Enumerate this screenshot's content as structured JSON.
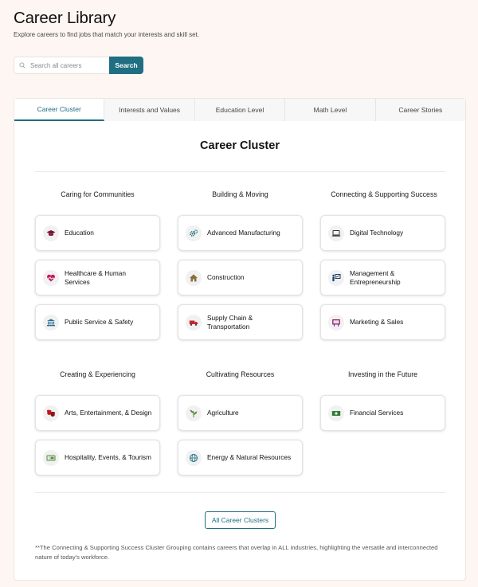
{
  "header": {
    "title": "Career Library",
    "subtitle": "Explore careers to find jobs that match your interests and skill set."
  },
  "search": {
    "placeholder": "Search all careers",
    "button_label": "Search"
  },
  "tabs": [
    {
      "label": "Career Cluster",
      "active": true
    },
    {
      "label": "Interests and Values",
      "active": false
    },
    {
      "label": "Education Level",
      "active": false
    },
    {
      "label": "Math Level",
      "active": false
    },
    {
      "label": "Career Stories",
      "active": false
    }
  ],
  "main": {
    "title": "Career Cluster",
    "groups": [
      {
        "heading": "Caring for Communities",
        "items": [
          {
            "label": "Education",
            "icon": "graduation-cap-icon",
            "color": "#7a1035"
          },
          {
            "label": "Healthcare & Human Services",
            "icon": "heart-pulse-icon",
            "color": "#c2185b"
          },
          {
            "label": "Public Service & Safety",
            "icon": "government-building-icon",
            "color": "#2a6f97"
          }
        ]
      },
      {
        "heading": "Building & Moving",
        "items": [
          {
            "label": "Advanced Manufacturing",
            "icon": "gears-icon",
            "color": "#1f6e82"
          },
          {
            "label": "Construction",
            "icon": "house-icon",
            "color": "#8a6d3b"
          },
          {
            "label": "Supply Chain & Transportation",
            "icon": "truck-icon",
            "color": "#c62828"
          }
        ]
      },
      {
        "heading": "Connecting & Supporting Success",
        "items": [
          {
            "label": "Digital Technology",
            "icon": "laptop-icon",
            "color": "#333333"
          },
          {
            "label": "Management & Entrepreneurship",
            "icon": "presentation-icon",
            "color": "#1a3a6b"
          },
          {
            "label": "Marketing & Sales",
            "icon": "billboard-icon",
            "color": "#7b1f6a"
          }
        ]
      },
      {
        "heading": "Creating & Experiencing",
        "items": [
          {
            "label": "Arts, Entertainment, & Design",
            "icon": "theater-masks-icon",
            "color": "#b71c1c"
          },
          {
            "label": "Hospitality, Events, & Tourism",
            "icon": "ticket-icon",
            "color": "#4f8a3c"
          }
        ]
      },
      {
        "heading": "Cultivating Resources",
        "items": [
          {
            "label": "Agriculture",
            "icon": "plant-icon",
            "color": "#4f8a3c"
          },
          {
            "label": "Energy & Natural Resources",
            "icon": "globe-leaf-icon",
            "color": "#1f6e82"
          }
        ]
      },
      {
        "heading": "Investing in the Future",
        "items": [
          {
            "label": "Financial Services",
            "icon": "money-bills-icon",
            "color": "#2e7d32"
          }
        ]
      }
    ],
    "all_clusters_label": "All Career Clusters",
    "footnote": "**The Connecting & Supporting Success Cluster Grouping contains careers that overlap in ALL industries, highlighting the versatile and interconnected nature of today's workforce."
  }
}
